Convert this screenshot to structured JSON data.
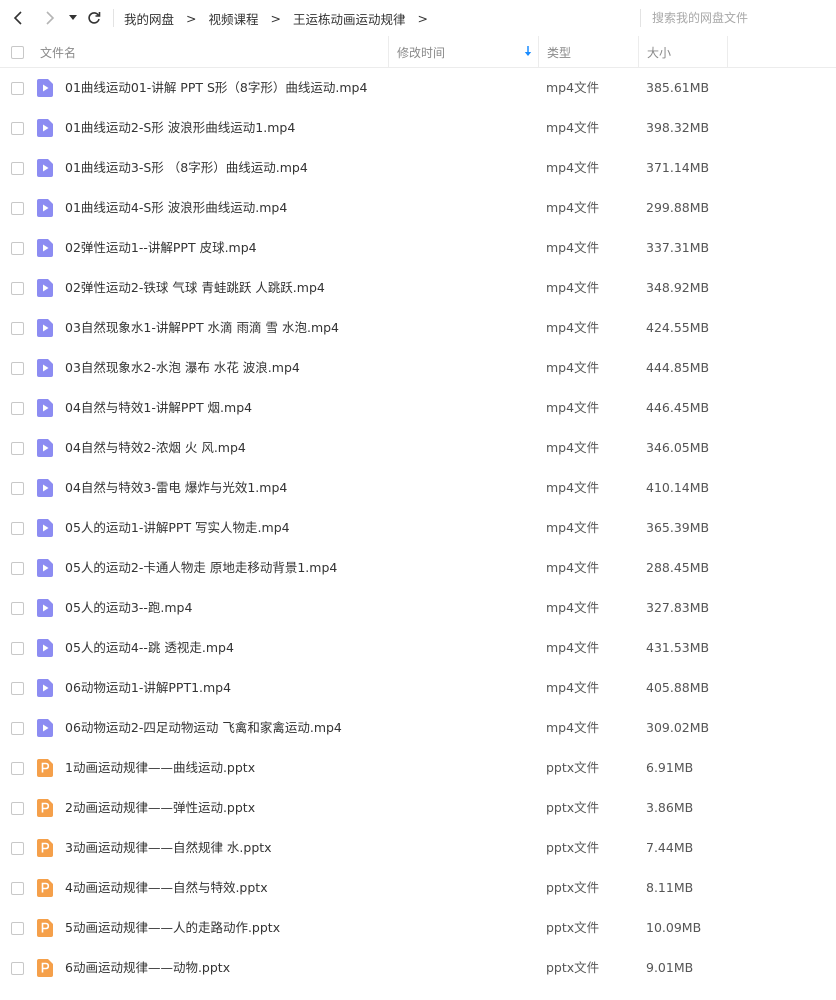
{
  "breadcrumb": [
    "我的网盘",
    "视频课程",
    "王运栋动画运动规律"
  ],
  "breadcrumb_sep": ">",
  "search": {
    "placeholder": "搜索我的网盘文件"
  },
  "columns": {
    "name": "文件名",
    "time": "修改时间",
    "type": "类型",
    "size": "大小"
  },
  "colors": {
    "video_icon": "#8c8cf2",
    "pptx_icon": "#f5a04a",
    "accent": "#1a8cff"
  },
  "icons": {
    "back": "chevron-left-icon",
    "forward": "chevron-right-icon",
    "dropdown": "caret-down-icon",
    "refresh": "refresh-icon",
    "sort": "sort-down-arrow-icon",
    "video": "video-file-icon",
    "pptx": "pptx-file-icon"
  },
  "files": [
    {
      "name": "01曲线运动01-讲解 PPT S形（8字形）曲线运动.mp4",
      "type": "mp4文件",
      "size": "385.61MB",
      "kind": "video"
    },
    {
      "name": "01曲线运动2-S形 波浪形曲线运动1.mp4",
      "type": "mp4文件",
      "size": "398.32MB",
      "kind": "video"
    },
    {
      "name": "01曲线运动3-S形 （8字形）曲线运动.mp4",
      "type": "mp4文件",
      "size": "371.14MB",
      "kind": "video"
    },
    {
      "name": "01曲线运动4-S形 波浪形曲线运动.mp4",
      "type": "mp4文件",
      "size": "299.88MB",
      "kind": "video"
    },
    {
      "name": "02弹性运动1--讲解PPT 皮球.mp4",
      "type": "mp4文件",
      "size": "337.31MB",
      "kind": "video"
    },
    {
      "name": "02弹性运动2-铁球 气球 青蛙跳跃 人跳跃.mp4",
      "type": "mp4文件",
      "size": "348.92MB",
      "kind": "video"
    },
    {
      "name": "03自然现象水1-讲解PPT 水滴 雨滴 雪 水泡.mp4",
      "type": "mp4文件",
      "size": "424.55MB",
      "kind": "video"
    },
    {
      "name": "03自然现象水2-水泡 瀑布 水花 波浪.mp4",
      "type": "mp4文件",
      "size": "444.85MB",
      "kind": "video"
    },
    {
      "name": "04自然与特效1-讲解PPT 烟.mp4",
      "type": "mp4文件",
      "size": "446.45MB",
      "kind": "video"
    },
    {
      "name": "04自然与特效2-浓烟 火 风.mp4",
      "type": "mp4文件",
      "size": "346.05MB",
      "kind": "video"
    },
    {
      "name": "04自然与特效3-雷电 爆炸与光效1.mp4",
      "type": "mp4文件",
      "size": "410.14MB",
      "kind": "video"
    },
    {
      "name": "05人的运动1-讲解PPT 写实人物走.mp4",
      "type": "mp4文件",
      "size": "365.39MB",
      "kind": "video"
    },
    {
      "name": "05人的运动2-卡通人物走 原地走移动背景1.mp4",
      "type": "mp4文件",
      "size": "288.45MB",
      "kind": "video"
    },
    {
      "name": "05人的运动3--跑.mp4",
      "type": "mp4文件",
      "size": "327.83MB",
      "kind": "video"
    },
    {
      "name": "05人的运动4--跳 透视走.mp4",
      "type": "mp4文件",
      "size": "431.53MB",
      "kind": "video"
    },
    {
      "name": "06动物运动1-讲解PPT1.mp4",
      "type": "mp4文件",
      "size": "405.88MB",
      "kind": "video"
    },
    {
      "name": "06动物运动2-四足动物运动 飞禽和家禽运动.mp4",
      "type": "mp4文件",
      "size": "309.02MB",
      "kind": "video"
    },
    {
      "name": "1动画运动规律——曲线运动.pptx",
      "type": "pptx文件",
      "size": "6.91MB",
      "kind": "pptx"
    },
    {
      "name": "2动画运动规律——弹性运动.pptx",
      "type": "pptx文件",
      "size": "3.86MB",
      "kind": "pptx"
    },
    {
      "name": "3动画运动规律——自然规律 水.pptx",
      "type": "pptx文件",
      "size": "7.44MB",
      "kind": "pptx"
    },
    {
      "name": "4动画运动规律——自然与特效.pptx",
      "type": "pptx文件",
      "size": "8.11MB",
      "kind": "pptx"
    },
    {
      "name": "5动画运动规律——人的走路动作.pptx",
      "type": "pptx文件",
      "size": "10.09MB",
      "kind": "pptx"
    },
    {
      "name": "6动画运动规律——动物.pptx",
      "type": "pptx文件",
      "size": "9.01MB",
      "kind": "pptx"
    }
  ]
}
